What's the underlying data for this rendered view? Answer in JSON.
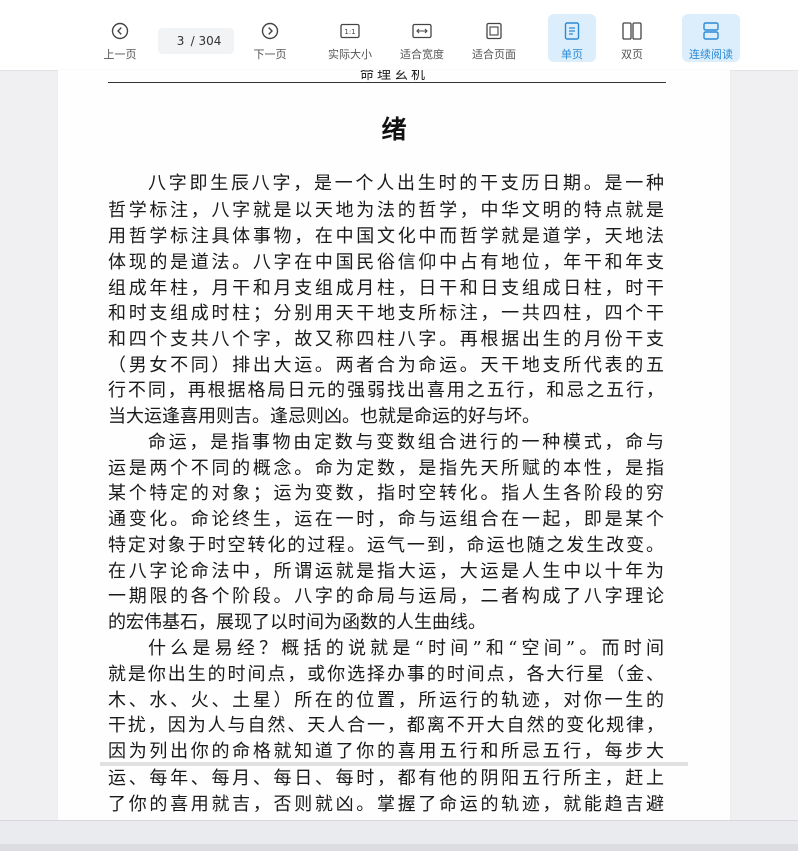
{
  "toolbar": {
    "prev_label": "上一页",
    "current_page": "3",
    "total_pages": "/ 304",
    "next_label": "下一页",
    "actual_size_label": "实际大小",
    "fit_width_label": "适合宽度",
    "fit_page_label": "适合页面",
    "single_page_label": "单页",
    "double_page_label": "双页",
    "continuous_label": "连续阅读",
    "actual_size_icon_text": "1:1",
    "accent_color": "#2b8ad6"
  },
  "document": {
    "running_head": "命理玄机",
    "chapter_title": "绪",
    "lines": [
      "八字即生辰八字，是一个人出生时的干支历日期。是一种",
      "哲学标注，八字就是以天地为法的哲学，中华文明的特点就是",
      "用哲学标注具体事物，在中国文化中而哲学就是道学，天地法",
      "体现的是道法。八字在中国民俗信仰中占有地位，年干和年支",
      "组成年柱，月干和月支组成月柱，日干和日支组成日柱，时干",
      "和时支组成时柱；分别用天干地支所标注，一共四柱，四个干",
      "和四个支共八个字，故又称四柱八字。再根据出生的月份干支",
      "（男女不同）排出大运。两者合为命运。天干地支所代表的五",
      "行不同，再根据格局日元的强弱找出喜用之五行，和忌之五行，",
      "当大运逢喜用则吉。逢忌则凶。也就是命运的好与坏。",
      "命运，是指事物由定数与变数组合进行的一种模式，命与",
      "运是两个不同的概念。命为定数，是指先天所赋的本性，是指",
      "某个特定的对象；运为变数，指时空转化。指人生各阶段的穷",
      "通变化。命论终生，运在一时，命与运组合在一起，即是某个",
      "特定对象于时空转化的过程。运气一到，命运也随之发生改变。",
      "在八字论命法中，所谓运就是指大运，大运是人生中以十年为",
      "一期限的各个阶段。八字的命局与运局，二者构成了八字理论",
      "的宏伟基石，展现了以时间为函数的人生曲线。",
      "什么是易经？概括的说就是“时间”和“空间”。而时间",
      "就是你出生的时间点，或你选择办事的时间点，各大行星（金、",
      "木、水、火、土星）所在的位置，所运行的轨迹，对你一生的",
      "干扰，因为人与自然、天人合一，都离不开大自然的变化规律，",
      "因为列出你的命格就知道了你的喜用五行和所忌五行，每步大",
      "运、每年、每月、每日、每时，都有他的阴阳五行所主，赶上",
      "了你的喜用就吉，否则就凶。掌握了命运的轨迹，就能趋吉避"
    ]
  }
}
